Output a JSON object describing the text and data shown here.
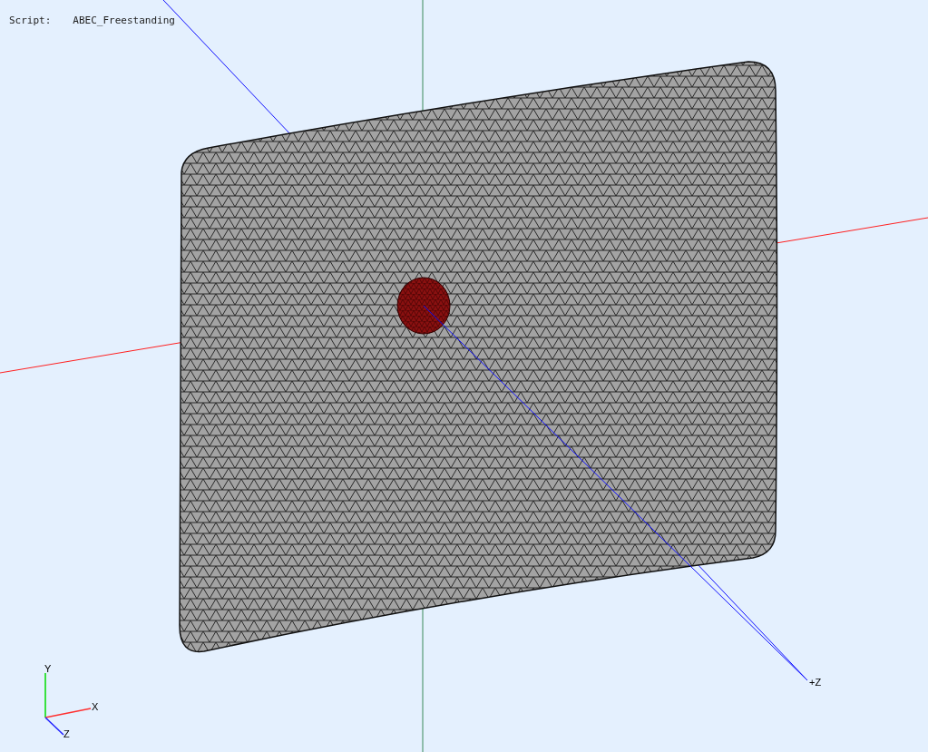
{
  "script": {
    "label": "Script:",
    "value": "ABEC_Freestanding"
  },
  "axis_label": "+Z",
  "triad_labels": [
    "Y",
    "X",
    "Z"
  ]
}
